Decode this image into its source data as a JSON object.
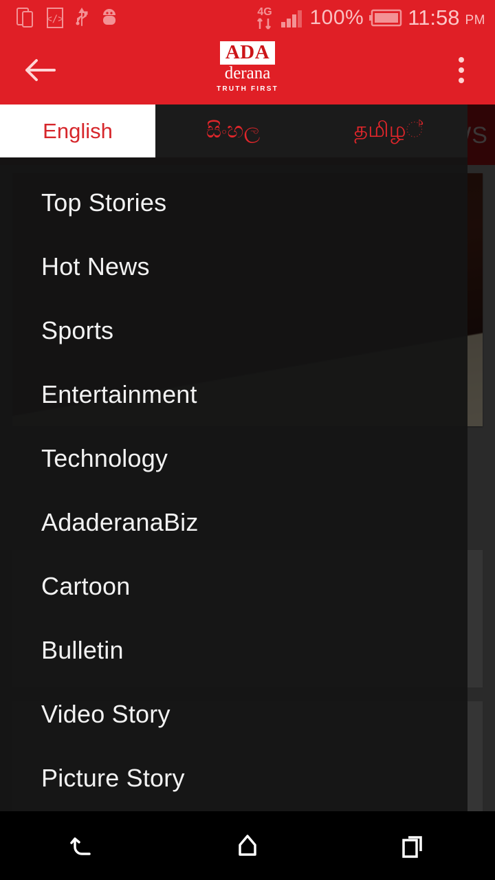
{
  "statusbar": {
    "icons": [
      "screen-mirror-icon",
      "developer-mode-icon",
      "usb-icon",
      "android-debug-icon"
    ],
    "network_type": "4G",
    "signal_icon": "signal-bars-icon",
    "battery_percent": "100%",
    "battery_icon": "battery-full-icon",
    "time": "11:58",
    "meridiem": "PM"
  },
  "appbar": {
    "back_icon": "arrow-left-icon",
    "overflow_icon": "more-vertical-icon",
    "logo": {
      "mark": "ADA",
      "name": "derana",
      "tagline": "TRUTH FIRST"
    },
    "background_color": "#e01f26"
  },
  "language_tabs": {
    "items": [
      {
        "label": "English",
        "active": true
      },
      {
        "label": "සිංහල",
        "active": false
      },
      {
        "label": "தமிழ්",
        "active": false
      }
    ],
    "active_text_color": "#d6262b",
    "inactive_text_color": "#e0262b"
  },
  "drawer": {
    "background_color": "#141414",
    "items": [
      {
        "label": "Top Stories"
      },
      {
        "label": "Hot News"
      },
      {
        "label": "Sports"
      },
      {
        "label": "Entertainment"
      },
      {
        "label": "Technology"
      },
      {
        "label": "AdaderanaBiz"
      },
      {
        "label": "Cartoon"
      },
      {
        "label": "Bulletin"
      },
      {
        "label": "Video Story"
      },
      {
        "label": "Picture Story"
      }
    ]
  },
  "background_page": {
    "news_bar_partial_text": "WS",
    "news_bar_color": "#7d0f10",
    "headline_partial": "",
    "page_color": "#707070"
  },
  "navbar": {
    "back_icon": "nav-back-icon",
    "home_icon": "nav-home-icon",
    "recents_icon": "nav-recents-icon",
    "background_color": "#000000"
  }
}
